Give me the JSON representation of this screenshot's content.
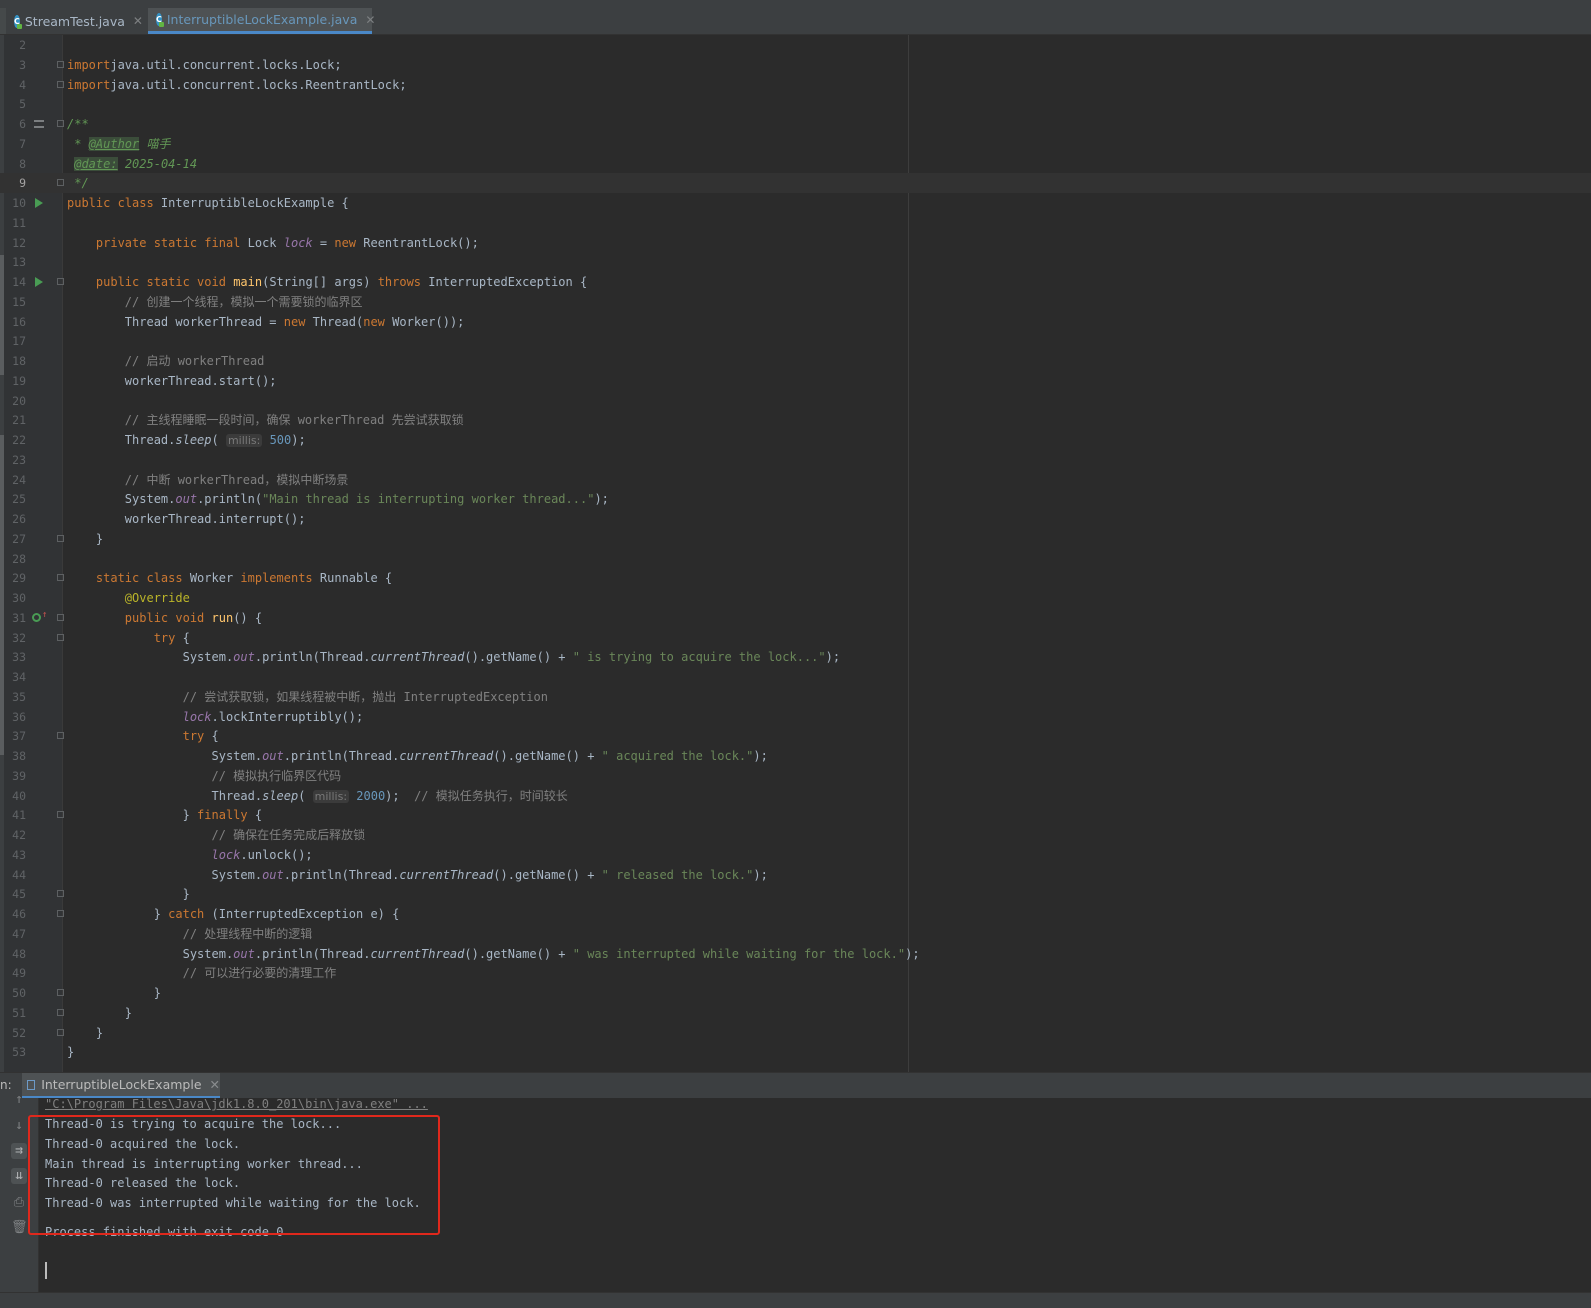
{
  "tabs": [
    {
      "label": "StreamTest.java",
      "icon": "java-class-icon",
      "active": false
    },
    {
      "label": "InterruptibleLockExample.java",
      "icon": "java-class-icon",
      "active": true
    }
  ],
  "editor": {
    "lines": [
      {
        "n": "2",
        "segs": []
      },
      {
        "n": "3",
        "segs": [
          [
            "kw",
            "import"
          ],
          [
            "",
            "java.util.concurrent.locks.Lock;"
          ]
        ],
        "fold": true
      },
      {
        "n": "4",
        "segs": [
          [
            "kw",
            "import"
          ],
          [
            "",
            "java.util.concurrent.locks.ReentrantLock;"
          ]
        ],
        "fold": true
      },
      {
        "n": "5",
        "segs": []
      },
      {
        "n": "6",
        "segs": [
          [
            "doc",
            "/**"
          ]
        ],
        "fold": true,
        "struct": true
      },
      {
        "n": "7",
        "segs": [
          [
            "doc",
            " * "
          ],
          [
            "tag",
            "@Author"
          ],
          [
            "doc",
            " 喵手"
          ]
        ]
      },
      {
        "n": "8",
        "segs": [
          [
            "doc",
            " "
          ],
          [
            "tag",
            "@date:"
          ],
          [
            "doc",
            " 2025-04-14"
          ]
        ],
        "bulb": true
      },
      {
        "n": "9",
        "segs": [
          [
            "doc",
            " */"
          ]
        ],
        "fold": true,
        "current": true
      },
      {
        "n": "10",
        "segs": [
          [
            "kw",
            "public class "
          ],
          [
            "",
            "InterruptibleLockExample {"
          ]
        ],
        "run": true
      },
      {
        "n": "11",
        "segs": []
      },
      {
        "n": "12",
        "segs": [
          [
            "",
            "    "
          ],
          [
            "kw",
            "private static final "
          ],
          [
            "",
            "Lock "
          ],
          [
            "st",
            "lock"
          ],
          [
            "",
            " = "
          ],
          [
            "kw",
            "new "
          ],
          [
            "",
            "ReentrantLock();"
          ]
        ]
      },
      {
        "n": "13",
        "segs": []
      },
      {
        "n": "14",
        "segs": [
          [
            "",
            "    "
          ],
          [
            "kw",
            "public static void "
          ],
          [
            "fn",
            "main"
          ],
          [
            "",
            "(String[] args) "
          ],
          [
            "kw",
            "throws "
          ],
          [
            "",
            "InterruptedException {"
          ]
        ],
        "run": true,
        "fold": true
      },
      {
        "n": "15",
        "segs": [
          [
            "cm",
            "        // 创建一个线程，模拟一个需要锁的临界区"
          ]
        ]
      },
      {
        "n": "16",
        "segs": [
          [
            "",
            "        Thread workerThread = "
          ],
          [
            "kw",
            "new "
          ],
          [
            "",
            "Thread("
          ],
          [
            "kw",
            "new "
          ],
          [
            "",
            "Worker());"
          ]
        ]
      },
      {
        "n": "17",
        "segs": []
      },
      {
        "n": "18",
        "segs": [
          [
            "cm",
            "        // 启动 workerThread"
          ]
        ]
      },
      {
        "n": "19",
        "segs": [
          [
            "",
            "        workerThread.start();"
          ]
        ]
      },
      {
        "n": "20",
        "segs": []
      },
      {
        "n": "21",
        "segs": [
          [
            "cm",
            "        // 主线程睡眠一段时间，确保 workerThread 先尝试获取锁"
          ]
        ]
      },
      {
        "n": "22",
        "segs": [
          [
            "",
            "        Thread."
          ],
          [
            "sm",
            "sleep"
          ],
          [
            "",
            "( "
          ],
          [
            "hint",
            "millis:"
          ],
          [
            "num",
            " 500"
          ],
          [
            "",
            ");"
          ]
        ]
      },
      {
        "n": "23",
        "segs": []
      },
      {
        "n": "24",
        "segs": [
          [
            "cm",
            "        // 中断 workerThread，模拟中断场景"
          ]
        ]
      },
      {
        "n": "25",
        "segs": [
          [
            "",
            "        System."
          ],
          [
            "st",
            "out"
          ],
          [
            "",
            ".println("
          ],
          [
            "str",
            "\"Main thread is interrupting worker thread...\""
          ],
          [
            "",
            ");"
          ]
        ]
      },
      {
        "n": "26",
        "segs": [
          [
            "",
            "        workerThread.interrupt();"
          ]
        ]
      },
      {
        "n": "27",
        "segs": [
          [
            "",
            "    }"
          ]
        ],
        "fold": true
      },
      {
        "n": "28",
        "segs": []
      },
      {
        "n": "29",
        "segs": [
          [
            "",
            "    "
          ],
          [
            "kw",
            "static class "
          ],
          [
            "",
            "Worker "
          ],
          [
            "kw",
            "implements "
          ],
          [
            "",
            "Runnable {"
          ]
        ],
        "fold": true
      },
      {
        "n": "30",
        "segs": [
          [
            "",
            "        "
          ],
          [
            "ann",
            "@Override"
          ]
        ]
      },
      {
        "n": "31",
        "segs": [
          [
            "",
            "        "
          ],
          [
            "kw",
            "public void "
          ],
          [
            "fn",
            "run"
          ],
          [
            "",
            "() {"
          ]
        ],
        "override": true,
        "fold": true
      },
      {
        "n": "32",
        "segs": [
          [
            "",
            "            "
          ],
          [
            "kw",
            "try "
          ],
          [
            "",
            "{"
          ]
        ],
        "fold": true
      },
      {
        "n": "33",
        "segs": [
          [
            "",
            "                System."
          ],
          [
            "st",
            "out"
          ],
          [
            "",
            ".println(Thread."
          ],
          [
            "sm",
            "currentThread"
          ],
          [
            "",
            "().getName() + "
          ],
          [
            "str",
            "\" is trying to acquire the lock...\""
          ],
          [
            "",
            ");"
          ]
        ]
      },
      {
        "n": "34",
        "segs": []
      },
      {
        "n": "35",
        "segs": [
          [
            "cm",
            "                // 尝试获取锁，如果线程被中断，抛出 InterruptedException"
          ]
        ]
      },
      {
        "n": "36",
        "segs": [
          [
            "",
            "                "
          ],
          [
            "st",
            "lock"
          ],
          [
            "",
            ".lockInterruptibly();"
          ]
        ]
      },
      {
        "n": "37",
        "segs": [
          [
            "",
            "                "
          ],
          [
            "kw",
            "try "
          ],
          [
            "",
            "{"
          ]
        ],
        "fold": true
      },
      {
        "n": "38",
        "segs": [
          [
            "",
            "                    System."
          ],
          [
            "st",
            "out"
          ],
          [
            "",
            ".println(Thread."
          ],
          [
            "sm",
            "currentThread"
          ],
          [
            "",
            "().getName() + "
          ],
          [
            "str",
            "\" acquired the lock.\""
          ],
          [
            "",
            ");"
          ]
        ]
      },
      {
        "n": "39",
        "segs": [
          [
            "cm",
            "                    // 模拟执行临界区代码"
          ]
        ]
      },
      {
        "n": "40",
        "segs": [
          [
            "",
            "                    Thread."
          ],
          [
            "sm",
            "sleep"
          ],
          [
            "",
            "( "
          ],
          [
            "hint",
            "millis:"
          ],
          [
            "num",
            " 2000"
          ],
          [
            "",
            ");  "
          ],
          [
            "cm",
            "// 模拟任务执行，时间较长"
          ]
        ]
      },
      {
        "n": "41",
        "segs": [
          [
            "",
            "                } "
          ],
          [
            "kw",
            "finally "
          ],
          [
            "",
            "{"
          ]
        ],
        "fold": true
      },
      {
        "n": "42",
        "segs": [
          [
            "cm",
            "                    // 确保在任务完成后释放锁"
          ]
        ]
      },
      {
        "n": "43",
        "segs": [
          [
            "",
            "                    "
          ],
          [
            "st",
            "lock"
          ],
          [
            "",
            ".unlock();"
          ]
        ]
      },
      {
        "n": "44",
        "segs": [
          [
            "",
            "                    System."
          ],
          [
            "st",
            "out"
          ],
          [
            "",
            ".println(Thread."
          ],
          [
            "sm",
            "currentThread"
          ],
          [
            "",
            "().getName() + "
          ],
          [
            "str",
            "\" released the lock.\""
          ],
          [
            "",
            ");"
          ]
        ]
      },
      {
        "n": "45",
        "segs": [
          [
            "",
            "                }"
          ]
        ],
        "fold": true
      },
      {
        "n": "46",
        "segs": [
          [
            "",
            "            } "
          ],
          [
            "kw",
            "catch "
          ],
          [
            "",
            "(InterruptedException e) {"
          ]
        ],
        "fold": true
      },
      {
        "n": "47",
        "segs": [
          [
            "cm",
            "                // 处理线程中断的逻辑"
          ]
        ]
      },
      {
        "n": "48",
        "segs": [
          [
            "",
            "                System."
          ],
          [
            "st",
            "out"
          ],
          [
            "",
            ".println(Thread."
          ],
          [
            "sm",
            "currentThread"
          ],
          [
            "",
            "().getName() + "
          ],
          [
            "str",
            "\" was interrupted while waiting for the lock.\""
          ],
          [
            "",
            ");"
          ]
        ]
      },
      {
        "n": "49",
        "segs": [
          [
            "cm",
            "                // 可以进行必要的清理工作"
          ]
        ]
      },
      {
        "n": "50",
        "segs": [
          [
            "",
            "            }"
          ]
        ],
        "fold": true
      },
      {
        "n": "51",
        "segs": [
          [
            "",
            "        }"
          ]
        ],
        "fold": true
      },
      {
        "n": "52",
        "segs": [
          [
            "",
            "    }"
          ]
        ],
        "fold": true
      },
      {
        "n": "53",
        "segs": [
          [
            "",
            "}"
          ]
        ]
      }
    ]
  },
  "run_panel": {
    "prefix": "n:",
    "tab_label": "InterruptibleLockExample",
    "command": "\"C:\\Program Files\\Java\\jdk1.8.0_201\\bin\\java.exe\" ...",
    "output": [
      "Thread-0 is trying to acquire the lock...",
      "Thread-0 acquired the lock.",
      "Main thread is interrupting worker thread...",
      "Thread-0 released the lock.",
      "Thread-0 was interrupted while waiting for the lock."
    ],
    "exit_message": "Process finished with exit code 0",
    "toolbar": [
      {
        "icon": "arrow-up-icon",
        "glyph": "↑"
      },
      {
        "icon": "arrow-down-icon",
        "glyph": "↓"
      },
      {
        "icon": "soft-wrap-icon",
        "glyph": "⇉",
        "active": true
      },
      {
        "icon": "scroll-to-end-icon",
        "glyph": "⇊",
        "active": true
      },
      {
        "icon": "print-icon",
        "glyph": "⎙"
      },
      {
        "icon": "trash-icon",
        "glyph": "🗑"
      }
    ]
  },
  "colors": {
    "highlight_box": "#e0281c",
    "accent": "#4a88c7"
  }
}
